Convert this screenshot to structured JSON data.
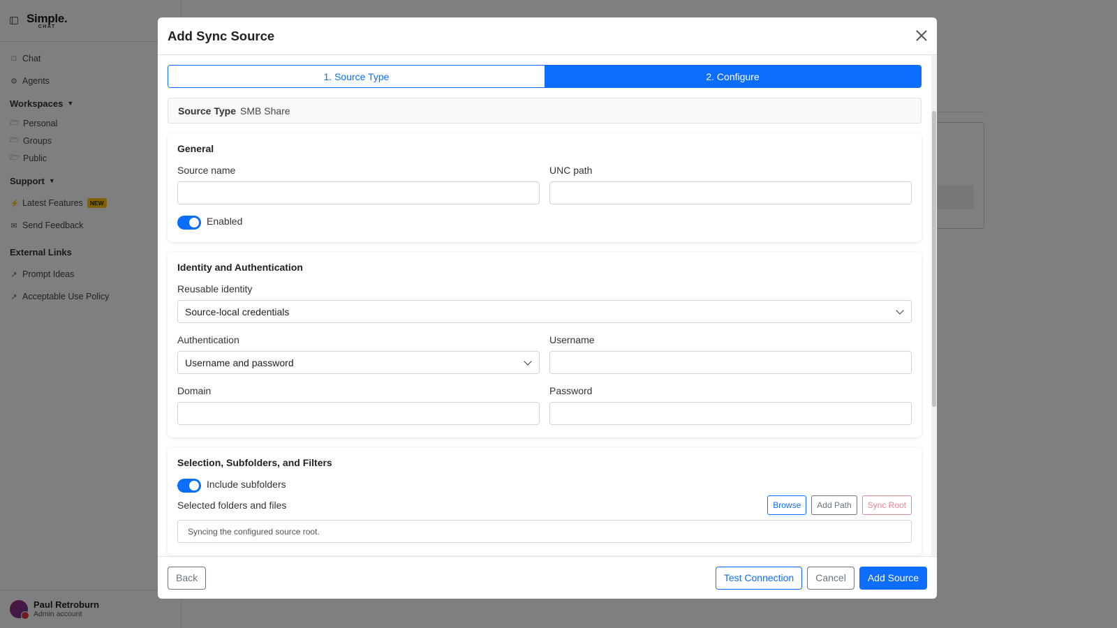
{
  "sidebar": {
    "logo_main": "Simple.",
    "logo_sub": "CHAT",
    "items": [
      {
        "label": "Chat",
        "icon": "chat-icon"
      },
      {
        "label": "Agents",
        "icon": "robot-icon"
      }
    ],
    "workspaces": {
      "heading": "Workspaces",
      "items": [
        "Personal",
        "Groups",
        "Public"
      ]
    },
    "support": {
      "heading": "Support",
      "latest_features": "Latest Features",
      "new_badge": "NEW",
      "send_feedback": "Send Feedback"
    },
    "external": {
      "heading": "External Links",
      "items": [
        "Prompt Ideas",
        "Acceptable Use Policy"
      ]
    },
    "user": {
      "name": "Paul Retroburn",
      "role": "Admin account"
    }
  },
  "modal": {
    "title": "Add Sync Source",
    "steps": [
      "1. Source Type",
      "2. Configure"
    ],
    "active_step": 2,
    "source_type": {
      "label": "Source Type",
      "value": "SMB Share"
    },
    "general": {
      "heading": "General",
      "source_name_label": "Source name",
      "source_name_value": "",
      "unc_path_label": "UNC path",
      "unc_path_value": "",
      "enabled_label": "Enabled",
      "enabled": true
    },
    "identity": {
      "heading": "Identity and Authentication",
      "reusable_identity_label": "Reusable identity",
      "reusable_identity_value": "Source-local credentials",
      "authentication_label": "Authentication",
      "authentication_value": "Username and password",
      "username_label": "Username",
      "username_value": "",
      "domain_label": "Domain",
      "domain_value": "",
      "password_label": "Password",
      "password_value": ""
    },
    "selection": {
      "heading": "Selection, Subfolders, and Filters",
      "include_subfolders_label": "Include subfolders",
      "include_subfolders": true,
      "selected_label": "Selected folders and files",
      "browse": "Browse",
      "add_path": "Add Path",
      "sync_root": "Sync Root",
      "note": "Syncing the configured source root."
    },
    "footer": {
      "back": "Back",
      "test_connection": "Test Connection",
      "cancel": "Cancel",
      "add_source": "Add Source"
    }
  },
  "colors": {
    "primary": "#0d6efd",
    "overlay": "rgba(0,0,0,0.5)",
    "new_badge": "#ffc107"
  }
}
